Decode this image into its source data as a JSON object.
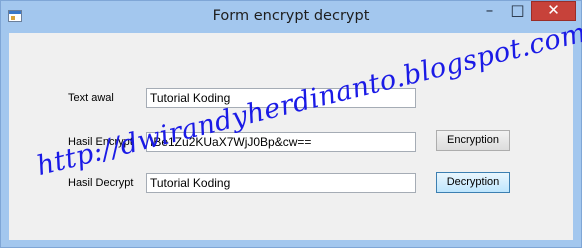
{
  "window": {
    "title": "Form encrypt decrypt",
    "controls": {
      "minimize": "–",
      "maximize": "□",
      "close": "✕"
    }
  },
  "form": {
    "text_awal": {
      "label": "Text awal",
      "value": "Tutorial Koding"
    },
    "hasil_encrypt": {
      "label": "Hasil Encrypt",
      "value": "IBe1Zu2KUaX7WjJ0Bp&cw=="
    },
    "hasil_decrypt": {
      "label": "Hasil Decrypt",
      "value": "Tutorial Koding"
    },
    "encrypt_button": "Encryption",
    "decrypt_button": "Decryption"
  },
  "watermark": "http://dwirandyherdinanto.blogspot.com/",
  "colors": {
    "title_bar": "#a3c7ee",
    "client_bg": "#f0f0f0",
    "close_button": "#c7423a",
    "watermark": "#1a1ae6"
  }
}
